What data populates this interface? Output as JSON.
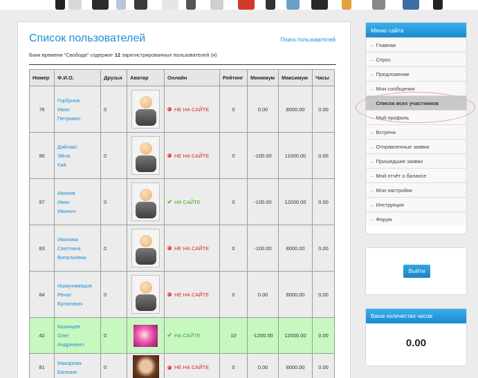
{
  "page": {
    "title": "Список пользователей",
    "search_link": "Поиск пользователей",
    "summary_prefix": "Банк времени \"Свобода\" содержит",
    "summary_count": "12",
    "summary_suffix": "зарегистрированных пользователей (я)"
  },
  "table": {
    "headers": [
      "Номер",
      "Ф.И.О.",
      "Друзья",
      "Аватар",
      "Онлайн",
      "Рейтинг",
      "Минимум",
      "Максимум",
      "Часы"
    ],
    "rows": [
      {
        "num": "76",
        "name": [
          "Горбунов",
          "Иван",
          "Петрович"
        ],
        "friends": "0",
        "avatar": "default",
        "status": "НЕ НА САЙТЕ",
        "online": false,
        "rating": "0",
        "min": "0.00",
        "max": "8000.00",
        "hours": "0.00"
      },
      {
        "num": "96",
        "name": [
          "Дайлакс",
          "Эйла",
          "Кай"
        ],
        "friends": "0",
        "avatar": "default",
        "status": "НЕ НА САЙТЕ",
        "online": false,
        "rating": "0",
        "min": "-100.00",
        "max": "11000.00",
        "hours": "0.00"
      },
      {
        "num": "97",
        "name": [
          "Иванов",
          "Иван",
          "Иваныч"
        ],
        "friends": "0",
        "avatar": "default",
        "status": "НА САЙТЕ",
        "online": true,
        "rating": "0",
        "min": "-100.00",
        "max": "12000.00",
        "hours": "0.00"
      },
      {
        "num": "83",
        "name": [
          "Иванова",
          "Светлана",
          "Витальевна"
        ],
        "friends": "0",
        "avatar": "default",
        "status": "НЕ НА САЙТЕ",
        "online": false,
        "rating": "0",
        "min": "-100.00",
        "max": "8000.00",
        "hours": "0.00"
      },
      {
        "num": "84",
        "name": [
          "Ишмухамедов",
          "Ренат",
          "Булатович"
        ],
        "friends": "0",
        "avatar": "default",
        "status": "НЕ НА САЙТЕ",
        "online": false,
        "rating": "0",
        "min": "0.00",
        "max": "8000.00",
        "hours": "0.00"
      },
      {
        "num": "42",
        "name": [
          "Казанцев",
          "Олег",
          "Андреевич"
        ],
        "friends": "0",
        "avatar": "orchid",
        "status": "НА САЙТЕ",
        "online": true,
        "rating": "10",
        "min": "-1200.00",
        "max": "12000.00",
        "hours": "0.00",
        "highlight": true
      },
      {
        "num": "81",
        "name": [
          "Макарова",
          "Евгения",
          ""
        ],
        "friends": "0",
        "avatar": "photo",
        "status": "НЕ НА САЙТЕ",
        "online": false,
        "rating": "0",
        "min": "0.00",
        "max": "8000.00",
        "hours": "0.00"
      }
    ]
  },
  "sidebar": {
    "menu_title": "Меню сайта",
    "items": [
      {
        "label": "Главная"
      },
      {
        "label": "Спрос"
      },
      {
        "label": "Предложение"
      },
      {
        "label": "Мои сообщения"
      },
      {
        "label": "Список всех участников",
        "active": true
      },
      {
        "label": "Мой профиль"
      },
      {
        "label": "Встречи"
      },
      {
        "label": "Отправленные заявки"
      },
      {
        "label": "Пришедшие заявки"
      },
      {
        "label": "Мой отчёт о балансе"
      },
      {
        "label": "Мои настройки"
      },
      {
        "label": "Инструкция"
      },
      {
        "label": "Форум"
      }
    ],
    "logout_label": "Выйти",
    "hours_title": "Ваше количество часов:",
    "hours_value": "0.00"
  },
  "colors": {
    "accent": "#1c8ed6",
    "online_row": "#c6f8c0",
    "offline_text": "#d02a2a",
    "online_text": "#3fa82a"
  }
}
